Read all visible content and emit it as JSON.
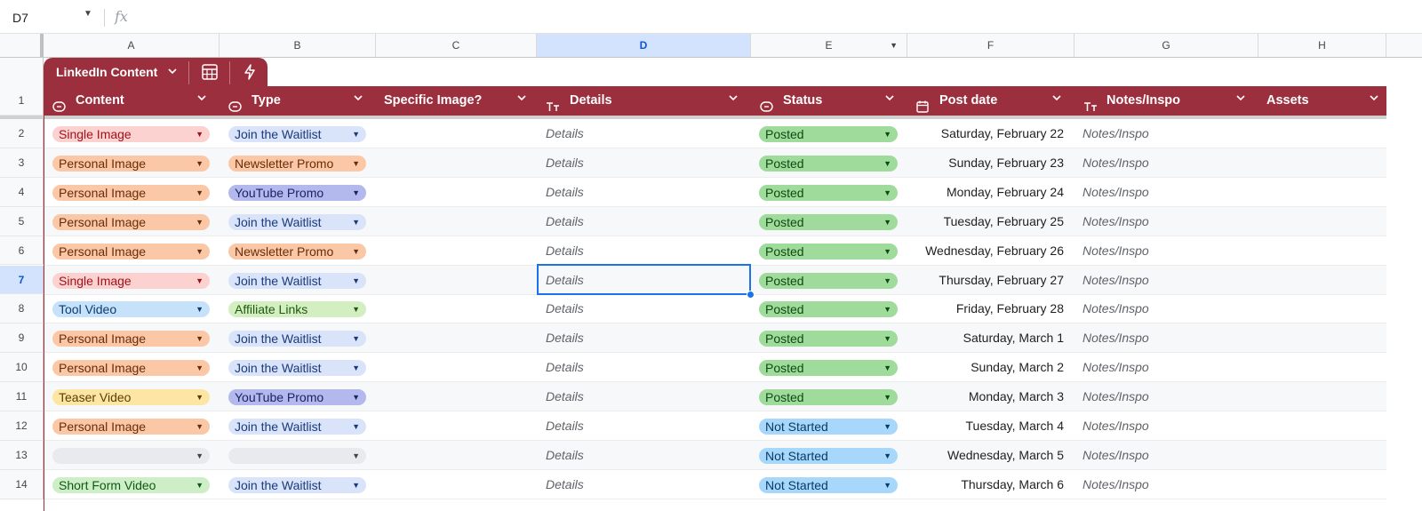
{
  "formula_bar": {
    "cell_ref": "D7",
    "fx_label": "fx"
  },
  "columns": [
    "A",
    "B",
    "C",
    "D",
    "E",
    "F",
    "G",
    "H"
  ],
  "table": {
    "name": "LinkedIn Content",
    "headers": [
      "Content",
      "Type",
      "Specific Image?",
      "Details",
      "Status",
      "Post date",
      "Notes/Inspo",
      "Assets"
    ]
  },
  "colors": {
    "table_header": "#9c2f3d",
    "selection": "#1a73e8",
    "chip_single_image": "#fbd2cf",
    "chip_personal_image": "#fbc8a7",
    "chip_tool_video": "#c6e2fb",
    "chip_teaser_video": "#fde6a4",
    "chip_short_form": "#cdeec7",
    "chip_waitlist": "#d9e4fa",
    "chip_newsletter": "#fbc8a7",
    "chip_youtube": "#b4b9ed",
    "chip_affiliate": "#d3efc2",
    "chip_posted": "#9fdc9c",
    "chip_not_started": "#a7d8fb"
  },
  "rows": [
    {
      "num": "1"
    },
    {
      "num": "2",
      "content": "Single Image",
      "type": "Join the Waitlist",
      "details": "Details",
      "status": "Posted",
      "date": "Saturday, February 22",
      "notes": "Notes/Inspo"
    },
    {
      "num": "3",
      "content": "Personal Image",
      "type": "Newsletter Promo",
      "details": "Details",
      "status": "Posted",
      "date": "Sunday, February 23",
      "notes": "Notes/Inspo"
    },
    {
      "num": "4",
      "content": "Personal Image",
      "type": "YouTube Promo",
      "details": "Details",
      "status": "Posted",
      "date": "Monday, February 24",
      "notes": "Notes/Inspo"
    },
    {
      "num": "5",
      "content": "Personal Image",
      "type": "Join the Waitlist",
      "details": "Details",
      "status": "Posted",
      "date": "Tuesday, February 25",
      "notes": "Notes/Inspo"
    },
    {
      "num": "6",
      "content": "Personal Image",
      "type": "Newsletter Promo",
      "details": "Details",
      "status": "Posted",
      "date": "Wednesday, February 26",
      "notes": "Notes/Inspo"
    },
    {
      "num": "7",
      "content": "Single Image",
      "type": "Join the Waitlist",
      "details": "Details",
      "status": "Posted",
      "date": "Thursday, February 27",
      "notes": "Notes/Inspo"
    },
    {
      "num": "8",
      "content": "Tool Video",
      "type": "Affiliate Links",
      "details": "Details",
      "status": "Posted",
      "date": "Friday, February 28",
      "notes": "Notes/Inspo"
    },
    {
      "num": "9",
      "content": "Personal Image",
      "type": "Join the Waitlist",
      "details": "Details",
      "status": "Posted",
      "date": "Saturday, March 1",
      "notes": "Notes/Inspo"
    },
    {
      "num": "10",
      "content": "Personal Image",
      "type": "Join the Waitlist",
      "details": "Details",
      "status": "Posted",
      "date": "Sunday, March 2",
      "notes": "Notes/Inspo"
    },
    {
      "num": "11",
      "content": "Teaser Video",
      "type": "YouTube Promo",
      "details": "Details",
      "status": "Posted",
      "date": "Monday, March 3",
      "notes": "Notes/Inspo"
    },
    {
      "num": "12",
      "content": "Personal Image",
      "type": "Join the Waitlist",
      "details": "Details",
      "status": "Not Started",
      "date": "Tuesday, March 4",
      "notes": "Notes/Inspo"
    },
    {
      "num": "13",
      "content": "",
      "type": "",
      "details": "Details",
      "status": "Not Started",
      "date": "Wednesday, March 5",
      "notes": "Notes/Inspo"
    },
    {
      "num": "14",
      "content": "Short Form Video",
      "type": "Join the Waitlist",
      "details": "Details",
      "status": "Not Started",
      "date": "Thursday, March 6",
      "notes": "Notes/Inspo"
    }
  ]
}
